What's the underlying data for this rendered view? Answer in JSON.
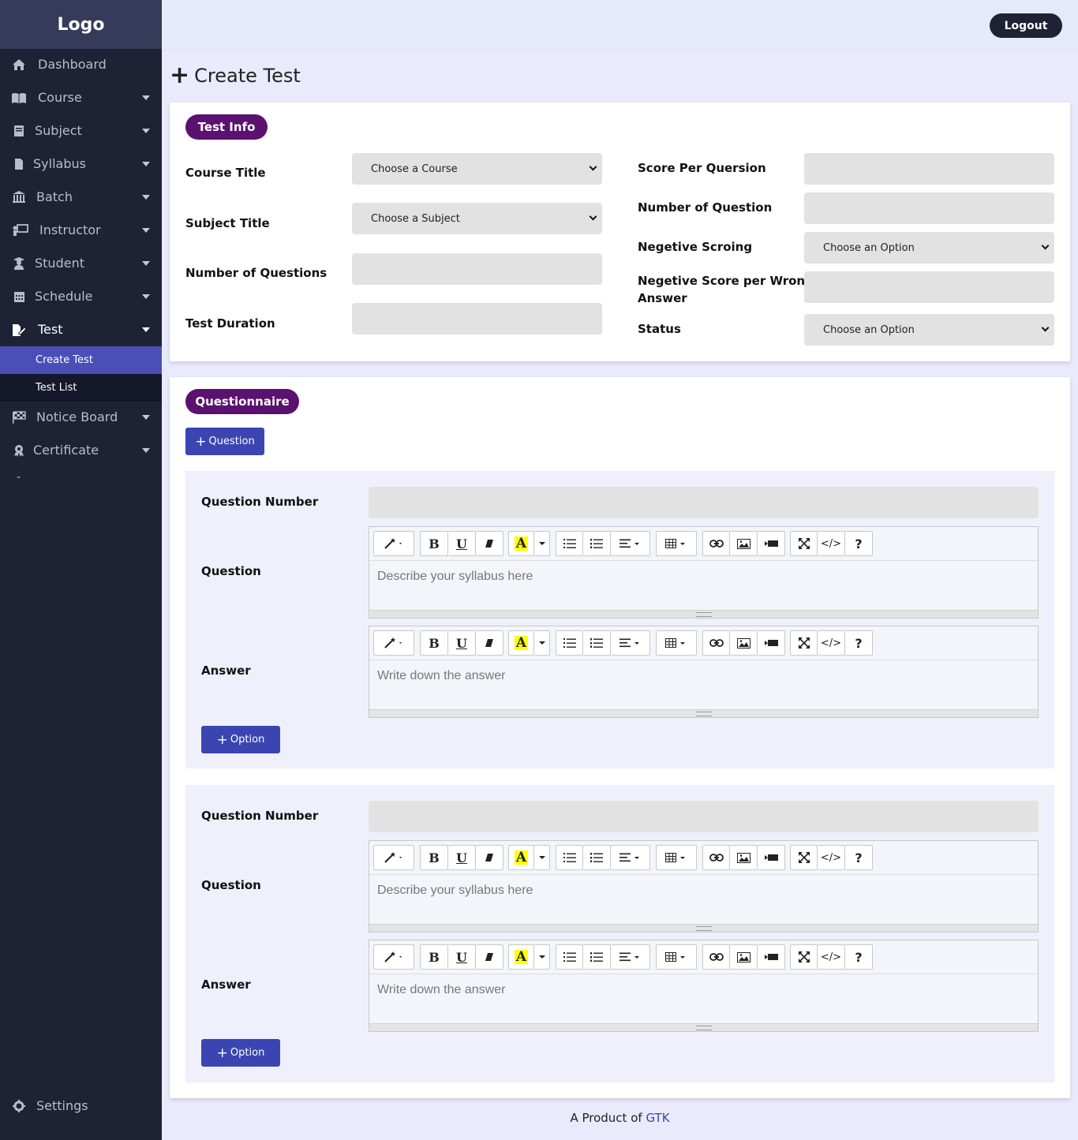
{
  "sidebar": {
    "logo": "Logo",
    "items": [
      {
        "label": "Dashboard"
      },
      {
        "label": "Course"
      },
      {
        "label": "Subject"
      },
      {
        "label": "Syllabus"
      },
      {
        "label": "Batch"
      },
      {
        "label": "Instructor"
      },
      {
        "label": "Student"
      },
      {
        "label": "Schedule"
      },
      {
        "label": "Test"
      },
      {
        "label": "Notice Board"
      },
      {
        "label": "Certificate"
      }
    ],
    "test_submenu": [
      {
        "label": "Create Test"
      },
      {
        "label": "Test List"
      }
    ],
    "dash_text": "-",
    "settings": "Settings"
  },
  "header": {
    "logout": "Logout"
  },
  "page": {
    "title": "Create Test"
  },
  "test_info": {
    "heading": "Test Info",
    "course_title": {
      "label": "Course Title",
      "selected": "Choose a Course"
    },
    "subject_title": {
      "label": "Subject Title",
      "selected": "Choose a Subject"
    },
    "number_of_questions": {
      "label": "Number of Questions",
      "value": ""
    },
    "test_duration": {
      "label": "Test Duration",
      "value": ""
    },
    "score_per_question": {
      "label": "Score Per Quersion",
      "value": ""
    },
    "number_of_question": {
      "label": "Number of Question",
      "value": ""
    },
    "negative_scoring": {
      "label": "Negetive Scroing",
      "selected": "Choose an Option"
    },
    "negative_score_per_wrong": {
      "label_line1": "Negetive Score per Wrong",
      "label_line2": "Answer",
      "value": ""
    },
    "status": {
      "label": "Status",
      "selected": "Choose an Option"
    }
  },
  "questionnaire": {
    "heading": "Questionnaire",
    "add_question": "Question",
    "blocks": [
      {
        "question_number_label": "Question Number",
        "question_label": "Question",
        "question_placeholder": "Describe your syllabus here",
        "answer_label": "Answer",
        "answer_placeholder": "Write down the answer",
        "add_option": "Option"
      },
      {
        "question_number_label": "Question Number",
        "question_label": "Question",
        "question_placeholder": "Describe your syllabus here",
        "answer_label": "Answer",
        "answer_placeholder": "Write down the answer",
        "add_option": "Option"
      }
    ]
  },
  "editor_toolbar": {
    "bold": "B",
    "underline": "U",
    "font_color": "A",
    "help": "?",
    "code": "</>"
  },
  "footer": {
    "prefix": "A Product of",
    "brand": "GTK"
  }
}
